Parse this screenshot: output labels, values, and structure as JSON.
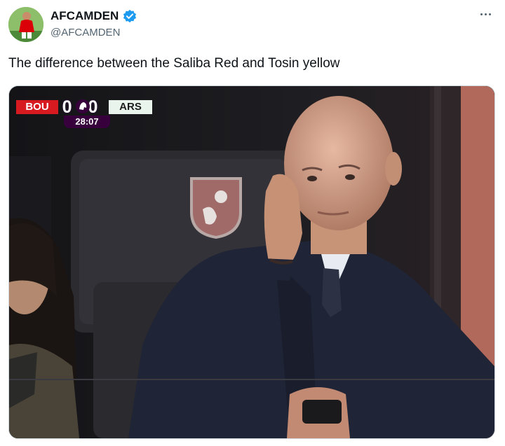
{
  "author": {
    "display_name": "AFCAMDEN",
    "handle": "@AFCAMDEN",
    "verified": true,
    "avatar_icon": "player-avatar"
  },
  "tweet": {
    "text": "The difference between the Saliba Red and Tosin yellow"
  },
  "scorebug": {
    "home": "BOU",
    "score": "0 0",
    "away": "ARS",
    "clock": "28:07",
    "league_icon": "premier-league-lion-icon",
    "colors": {
      "home": "#d71920",
      "away": "#e9f5ec",
      "clock": "#37003c"
    }
  },
  "media": {
    "crest_icon": "afc-bournemouth-crest"
  },
  "colors": {
    "verified": "#1d9bf0",
    "handle": "#536471",
    "text": "#0f1419"
  }
}
